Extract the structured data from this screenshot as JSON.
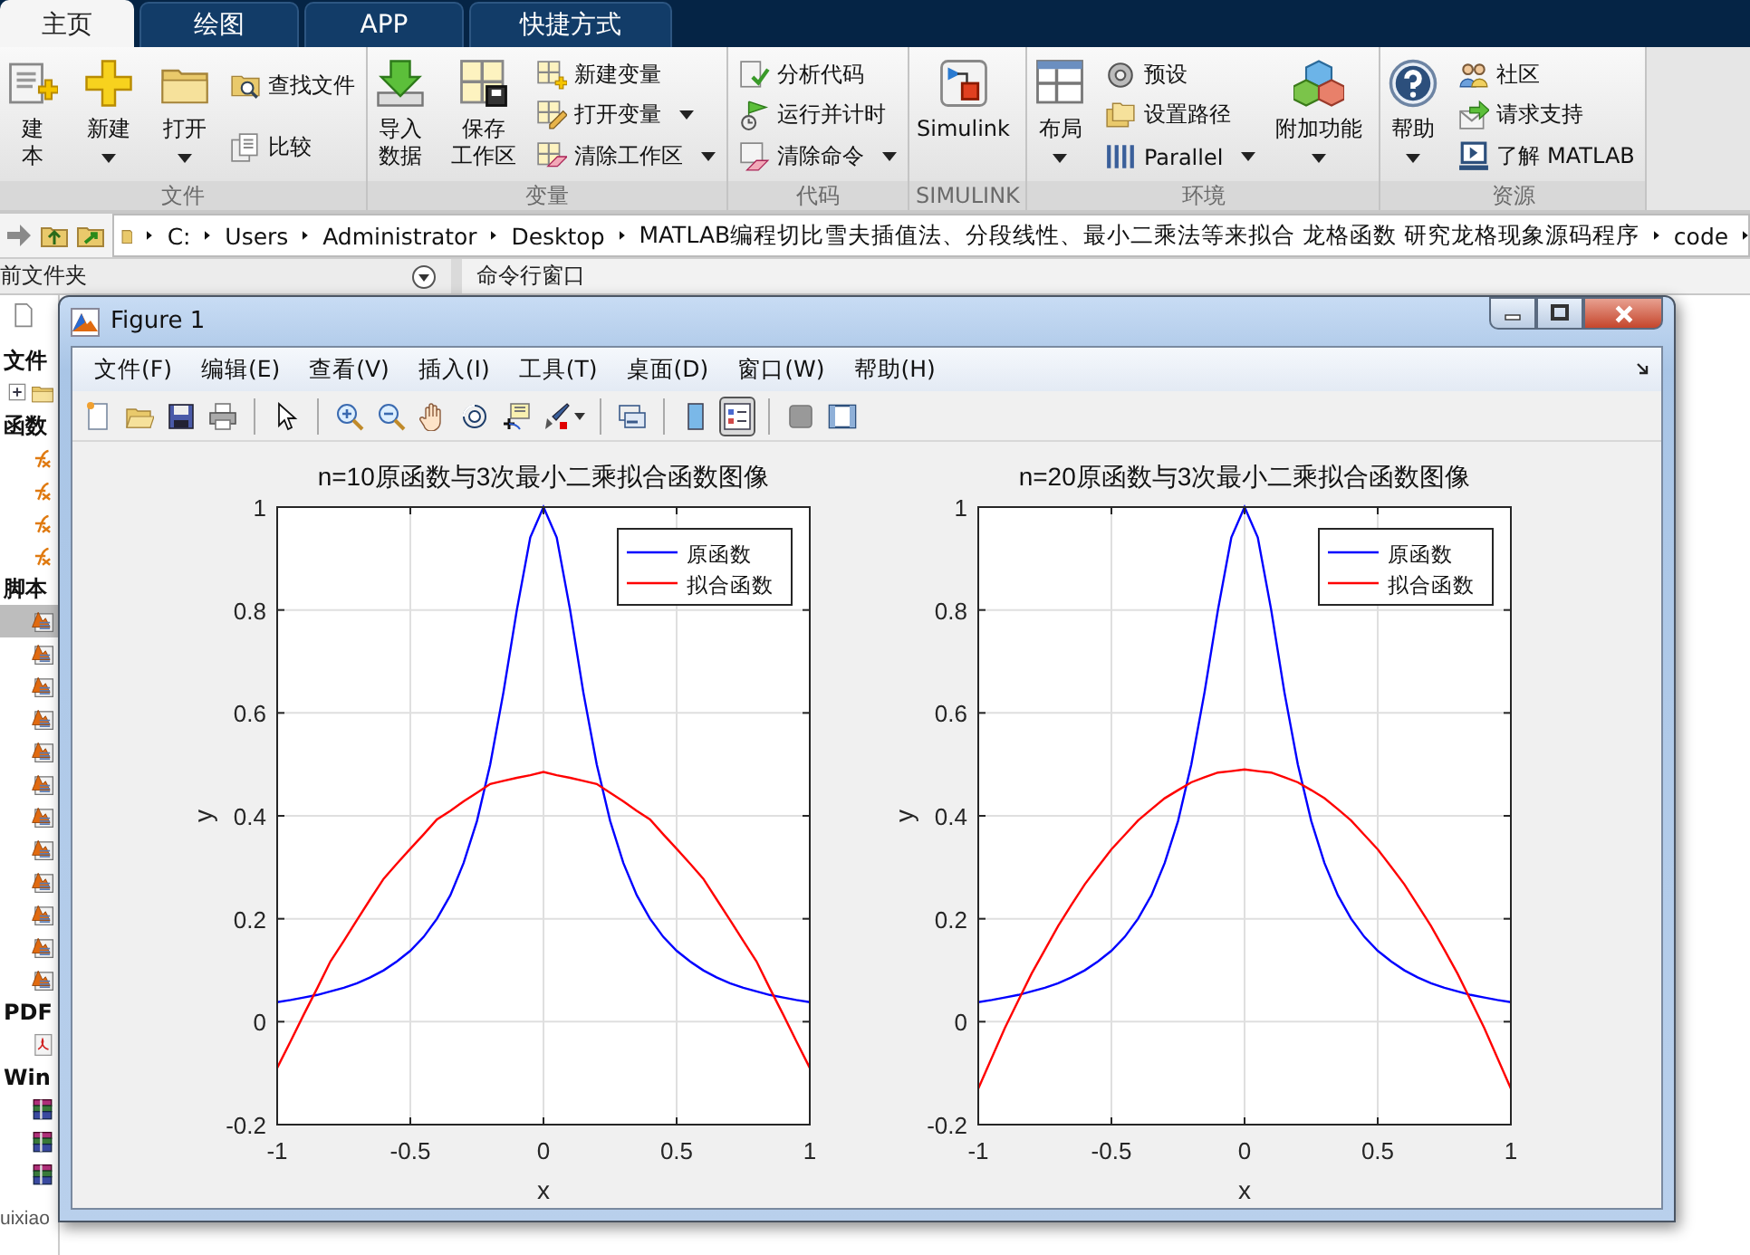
{
  "tabs": [
    {
      "label": "主页",
      "selected": true
    },
    {
      "label": "绘图",
      "selected": false
    },
    {
      "label": "APP",
      "selected": false
    },
    {
      "label": "快捷方式",
      "selected": false
    }
  ],
  "ribbon": {
    "groups": [
      {
        "label": "文件",
        "items": [
          {
            "kind": "large",
            "lines": [
              "建",
              "本"
            ],
            "dropdown": false
          },
          {
            "kind": "large",
            "lines": [
              "新建"
            ],
            "dropdown": true
          },
          {
            "kind": "large",
            "lines": [
              "打开"
            ],
            "dropdown": true
          },
          {
            "kind": "stack",
            "items": [
              {
                "label": "查找文件",
                "dropdown": false
              },
              {
                "label": "比较",
                "dropdown": false
              }
            ]
          }
        ]
      },
      {
        "label": "变量",
        "items": [
          {
            "kind": "large",
            "lines": [
              "导入",
              "数据"
            ],
            "dropdown": false
          },
          {
            "kind": "large",
            "lines": [
              "保存",
              "工作区"
            ],
            "dropdown": false
          },
          {
            "kind": "stack",
            "items": [
              {
                "label": "新建变量",
                "dropdown": false
              },
              {
                "label": "打开变量",
                "dropdown": true
              },
              {
                "label": "清除工作区",
                "dropdown": true
              }
            ]
          }
        ]
      },
      {
        "label": "代码",
        "items": [
          {
            "kind": "stack",
            "items": [
              {
                "label": "分析代码",
                "dropdown": false
              },
              {
                "label": "运行并计时",
                "dropdown": false
              },
              {
                "label": "清除命令",
                "dropdown": true
              }
            ]
          }
        ]
      },
      {
        "label": "SIMULINK",
        "items": [
          {
            "kind": "large",
            "lines": [
              "Simulink"
            ],
            "dropdown": false
          }
        ]
      },
      {
        "label": "环境",
        "items": [
          {
            "kind": "large",
            "lines": [
              "布局"
            ],
            "dropdown": true
          },
          {
            "kind": "stack",
            "items": [
              {
                "label": "预设",
                "dropdown": false
              },
              {
                "label": "设置路径",
                "dropdown": false
              },
              {
                "label": "Parallel",
                "dropdown": true
              }
            ]
          },
          {
            "kind": "large",
            "lines": [
              "附加功能"
            ],
            "dropdown": true
          }
        ]
      },
      {
        "label": "资源",
        "items": [
          {
            "kind": "large",
            "lines": [
              "帮助"
            ],
            "dropdown": true
          },
          {
            "kind": "stack",
            "items": [
              {
                "label": "社区",
                "dropdown": false
              },
              {
                "label": "请求支持",
                "dropdown": false
              },
              {
                "label": "了解 MATLAB",
                "dropdown": false
              }
            ]
          }
        ]
      }
    ]
  },
  "path": [
    "C:",
    "Users",
    "Administrator",
    "Desktop",
    "MATLAB编程切比雪夫插值法、分段线性、最小二乘法等来拟合 龙格函数 研究龙格现象源码程序",
    "code"
  ],
  "panels": {
    "left_title": "前文件夹",
    "right_title": "命令行窗口"
  },
  "left_panel": {
    "sections": [
      {
        "heading": "文件",
        "rows": [
          {
            "kind": "folder",
            "selected": false
          }
        ]
      },
      {
        "heading": "函数",
        "rows": [
          {
            "kind": "function",
            "selected": false
          },
          {
            "kind": "function",
            "selected": false
          },
          {
            "kind": "function",
            "selected": false
          },
          {
            "kind": "function",
            "selected": false
          }
        ]
      },
      {
        "heading": "脚本",
        "rows": [
          {
            "kind": "script",
            "selected": true
          },
          {
            "kind": "script",
            "selected": false
          },
          {
            "kind": "script",
            "selected": false
          },
          {
            "kind": "script",
            "selected": false
          },
          {
            "kind": "script",
            "selected": false
          },
          {
            "kind": "script",
            "selected": false
          },
          {
            "kind": "script",
            "selected": false
          },
          {
            "kind": "script",
            "selected": false
          },
          {
            "kind": "script",
            "selected": false
          },
          {
            "kind": "script",
            "selected": false
          },
          {
            "kind": "script",
            "selected": false
          },
          {
            "kind": "script",
            "selected": false
          }
        ]
      },
      {
        "heading": "PDF",
        "rows": [
          {
            "kind": "pdf",
            "selected": false
          }
        ]
      },
      {
        "heading": "Win",
        "rows": [
          {
            "kind": "archive",
            "selected": false
          },
          {
            "kind": "archive",
            "selected": false
          },
          {
            "kind": "archive",
            "selected": false
          }
        ]
      }
    ],
    "footer": "uixiao"
  },
  "figure": {
    "title": "Figure 1",
    "menu": [
      "文件(F)",
      "编辑(E)",
      "查看(V)",
      "插入(I)",
      "工具(T)",
      "桌面(D)",
      "窗口(W)",
      "帮助(H)"
    ],
    "toolbar": [
      [
        {
          "pressed": false
        },
        {
          "pressed": false
        },
        {
          "pressed": false
        },
        {
          "pressed": false
        }
      ],
      [
        {
          "pressed": false
        }
      ],
      [
        {
          "pressed": false
        },
        {
          "pressed": false
        },
        {
          "pressed": false
        },
        {
          "pressed": false
        },
        {
          "pressed": false
        },
        {
          "pressed": false,
          "dropdown": true
        }
      ],
      [
        {
          "pressed": false
        }
      ],
      [
        {
          "pressed": false
        },
        {
          "pressed": true
        }
      ],
      [
        {
          "pressed": false
        },
        {
          "pressed": false
        }
      ]
    ],
    "axes": [
      {
        "chart_data": {
          "type": "line",
          "title": "n=10原函数与3次最小二乘拟合函数图像",
          "xlabel": "x",
          "ylabel": "y",
          "grid": true,
          "legend": true,
          "xlim": [
            -1,
            1
          ],
          "ylim": [
            -0.2,
            1
          ],
          "xticks": [
            -1,
            -0.5,
            0,
            0.5,
            1
          ],
          "yticks": [
            -0.2,
            0,
            0.2,
            0.4,
            0.6,
            0.8,
            1
          ],
          "x": [
            -1,
            -0.95,
            -0.9,
            -0.85,
            -0.8,
            -0.75,
            -0.7,
            -0.65,
            -0.6,
            -0.55,
            -0.5,
            -0.45,
            -0.4,
            -0.35,
            -0.3,
            -0.25,
            -0.2,
            -0.15,
            -0.1,
            -0.05,
            0,
            0.05,
            0.1,
            0.15,
            0.2,
            0.25,
            0.3,
            0.35,
            0.4,
            0.45,
            0.5,
            0.55,
            0.6,
            0.65,
            0.7,
            0.75,
            0.8,
            0.85,
            0.9,
            0.95,
            1
          ],
          "series": [
            {
              "name": "原函数",
              "color": "#0000ff",
              "values": [
                0.038,
                0.042,
                0.047,
                0.052,
                0.059,
                0.066,
                0.075,
                0.086,
                0.1,
                0.117,
                0.138,
                0.165,
                0.2,
                0.246,
                0.308,
                0.39,
                0.5,
                0.64,
                0.8,
                0.941,
                1,
                0.941,
                0.8,
                0.64,
                0.5,
                0.39,
                0.308,
                0.246,
                0.2,
                0.165,
                0.138,
                0.117,
                0.1,
                0.086,
                0.075,
                0.066,
                0.059,
                0.052,
                0.047,
                0.042,
                0.038
              ]
            },
            {
              "name": "拟合函数",
              "color": "#ff0000",
              "values": [
                -0.09,
                -0.038,
                0.014,
                0.065,
                0.117,
                0.157,
                0.198,
                0.238,
                0.278,
                0.307,
                0.336,
                0.364,
                0.393,
                0.41,
                0.428,
                0.445,
                0.462,
                0.468,
                0.474,
                0.479,
                0.485,
                0.479,
                0.474,
                0.468,
                0.462,
                0.445,
                0.428,
                0.41,
                0.393,
                0.364,
                0.336,
                0.307,
                0.278,
                0.238,
                0.198,
                0.157,
                0.117,
                0.065,
                0.014,
                -0.038,
                -0.09
              ]
            }
          ]
        }
      },
      {
        "chart_data": {
          "type": "line",
          "title": "n=20原函数与3次最小二乘拟合函数图像",
          "xlabel": "x",
          "ylabel": "y",
          "grid": true,
          "legend": true,
          "xlim": [
            -1,
            1
          ],
          "ylim": [
            -0.2,
            1
          ],
          "xticks": [
            -1,
            -0.5,
            0,
            0.5,
            1
          ],
          "yticks": [
            -0.2,
            0,
            0.2,
            0.4,
            0.6,
            0.8,
            1
          ],
          "x": [
            -1,
            -0.95,
            -0.9,
            -0.85,
            -0.8,
            -0.75,
            -0.7,
            -0.65,
            -0.6,
            -0.55,
            -0.5,
            -0.45,
            -0.4,
            -0.35,
            -0.3,
            -0.25,
            -0.2,
            -0.15,
            -0.1,
            -0.05,
            0,
            0.05,
            0.1,
            0.15,
            0.2,
            0.25,
            0.3,
            0.35,
            0.4,
            0.45,
            0.5,
            0.55,
            0.6,
            0.65,
            0.7,
            0.75,
            0.8,
            0.85,
            0.9,
            0.95,
            1
          ],
          "series": [
            {
              "name": "原函数",
              "color": "#0000ff",
              "values": [
                0.038,
                0.042,
                0.047,
                0.052,
                0.059,
                0.066,
                0.075,
                0.086,
                0.1,
                0.117,
                0.138,
                0.165,
                0.2,
                0.246,
                0.308,
                0.39,
                0.5,
                0.64,
                0.8,
                0.941,
                1,
                0.941,
                0.8,
                0.64,
                0.5,
                0.39,
                0.308,
                0.246,
                0.2,
                0.165,
                0.138,
                0.117,
                0.1,
                0.086,
                0.075,
                0.066,
                0.059,
                0.052,
                0.047,
                0.042,
                0.038
              ]
            },
            {
              "name": "拟合函数",
              "color": "#ff0000",
              "values": [
                -0.13,
                -0.071,
                -0.012,
                0.041,
                0.093,
                0.14,
                0.186,
                0.227,
                0.267,
                0.301,
                0.335,
                0.363,
                0.391,
                0.413,
                0.434,
                0.45,
                0.465,
                0.475,
                0.484,
                0.487,
                0.49,
                0.487,
                0.484,
                0.475,
                0.465,
                0.45,
                0.434,
                0.413,
                0.391,
                0.363,
                0.335,
                0.301,
                0.267,
                0.227,
                0.186,
                0.14,
                0.093,
                0.041,
                -0.012,
                -0.071,
                -0.13
              ]
            }
          ]
        }
      }
    ]
  }
}
